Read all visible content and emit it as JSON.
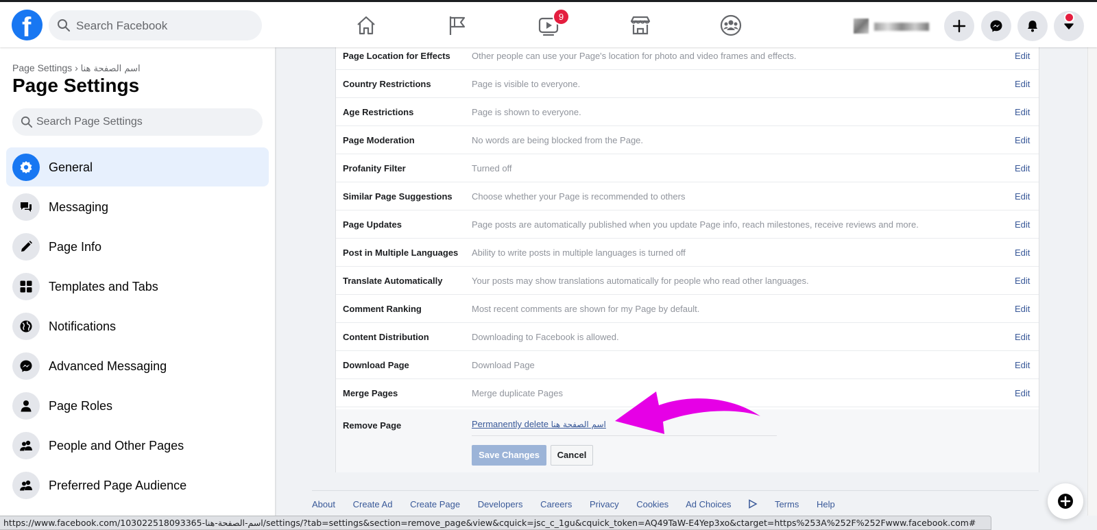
{
  "topbar": {
    "logo_letter": "f",
    "search_placeholder": "Search Facebook",
    "watch_badge": "9",
    "nav_icons": [
      "home-icon",
      "pages-flag-icon",
      "watch-icon",
      "marketplace-icon",
      "groups-icon"
    ],
    "right_icons": [
      "create-plus-icon",
      "messenger-icon",
      "notifications-bell-icon",
      "account-caret-icon"
    ]
  },
  "sidebar": {
    "breadcrumb_root": "Page Settings",
    "breadcrumb_sep": "›",
    "breadcrumb_page": "اسم الصفحة هنا",
    "title": "Page Settings",
    "search_placeholder": "Search Page Settings",
    "items": [
      {
        "label": "General",
        "icon": "gear-icon"
      },
      {
        "label": "Messaging",
        "icon": "chat-bubbles-icon"
      },
      {
        "label": "Page Info",
        "icon": "pencil-icon"
      },
      {
        "label": "Templates and Tabs",
        "icon": "grid-icon"
      },
      {
        "label": "Notifications",
        "icon": "globe-icon"
      },
      {
        "label": "Advanced Messaging",
        "icon": "messenger-icon"
      },
      {
        "label": "Page Roles",
        "icon": "person-icon"
      },
      {
        "label": "People and Other Pages",
        "icon": "people-icon"
      },
      {
        "label": "Preferred Page Audience",
        "icon": "people-icon"
      }
    ]
  },
  "settings": {
    "edit_label": "Edit",
    "rows": [
      {
        "key": "Page Location for Effects",
        "value": "Other people can use your Page's location for photo and video frames and effects."
      },
      {
        "key": "Country Restrictions",
        "value": "Page is visible to everyone."
      },
      {
        "key": "Age Restrictions",
        "value": "Page is shown to everyone."
      },
      {
        "key": "Page Moderation",
        "value": "No words are being blocked from the Page."
      },
      {
        "key": "Profanity Filter",
        "value": "Turned off"
      },
      {
        "key": "Similar Page Suggestions",
        "value": "Choose whether your Page is recommended to others"
      },
      {
        "key": "Page Updates",
        "value": "Page posts are automatically published when you update Page info, reach milestones, receive reviews and more."
      },
      {
        "key": "Post in Multiple Languages",
        "value": "Ability to write posts in multiple languages is turned off"
      },
      {
        "key": "Translate Automatically",
        "value": "Your posts may show translations automatically for people who read other languages."
      },
      {
        "key": "Comment Ranking",
        "value": "Most recent comments are shown for my Page by default."
      },
      {
        "key": "Content Distribution",
        "value": "Downloading to Facebook is allowed."
      },
      {
        "key": "Download Page",
        "value": "Download Page"
      },
      {
        "key": "Merge Pages",
        "value": "Merge duplicate Pages"
      }
    ],
    "remove": {
      "key": "Remove Page",
      "link_prefix": "Permanently delete ",
      "link_page": "اسم الصفحة هنا",
      "save_label": "Save Changes",
      "cancel_label": "Cancel"
    }
  },
  "annotation": {
    "arrow_color": "#e600e6"
  },
  "footer": {
    "links": [
      "About",
      "Create Ad",
      "Create Page",
      "Developers",
      "Careers",
      "Privacy",
      "Cookies",
      "Ad Choices",
      "Terms",
      "Help"
    ]
  },
  "statusbar": {
    "url": "https://www.facebook.com/103022518093365-اسم-الصفحة-هنا/settings/?tab=settings&section=remove_page&view&cquick=jsc_c_1gu&cquick_token=AQ49TaW-E4Yep3xo&ctarget=https%253A%252F%252Fwww.facebook.com#"
  },
  "colors": {
    "brand": "#1877f2",
    "link": "#385898",
    "badge": "#e41e3f",
    "active_bg": "#e7f0fd"
  }
}
